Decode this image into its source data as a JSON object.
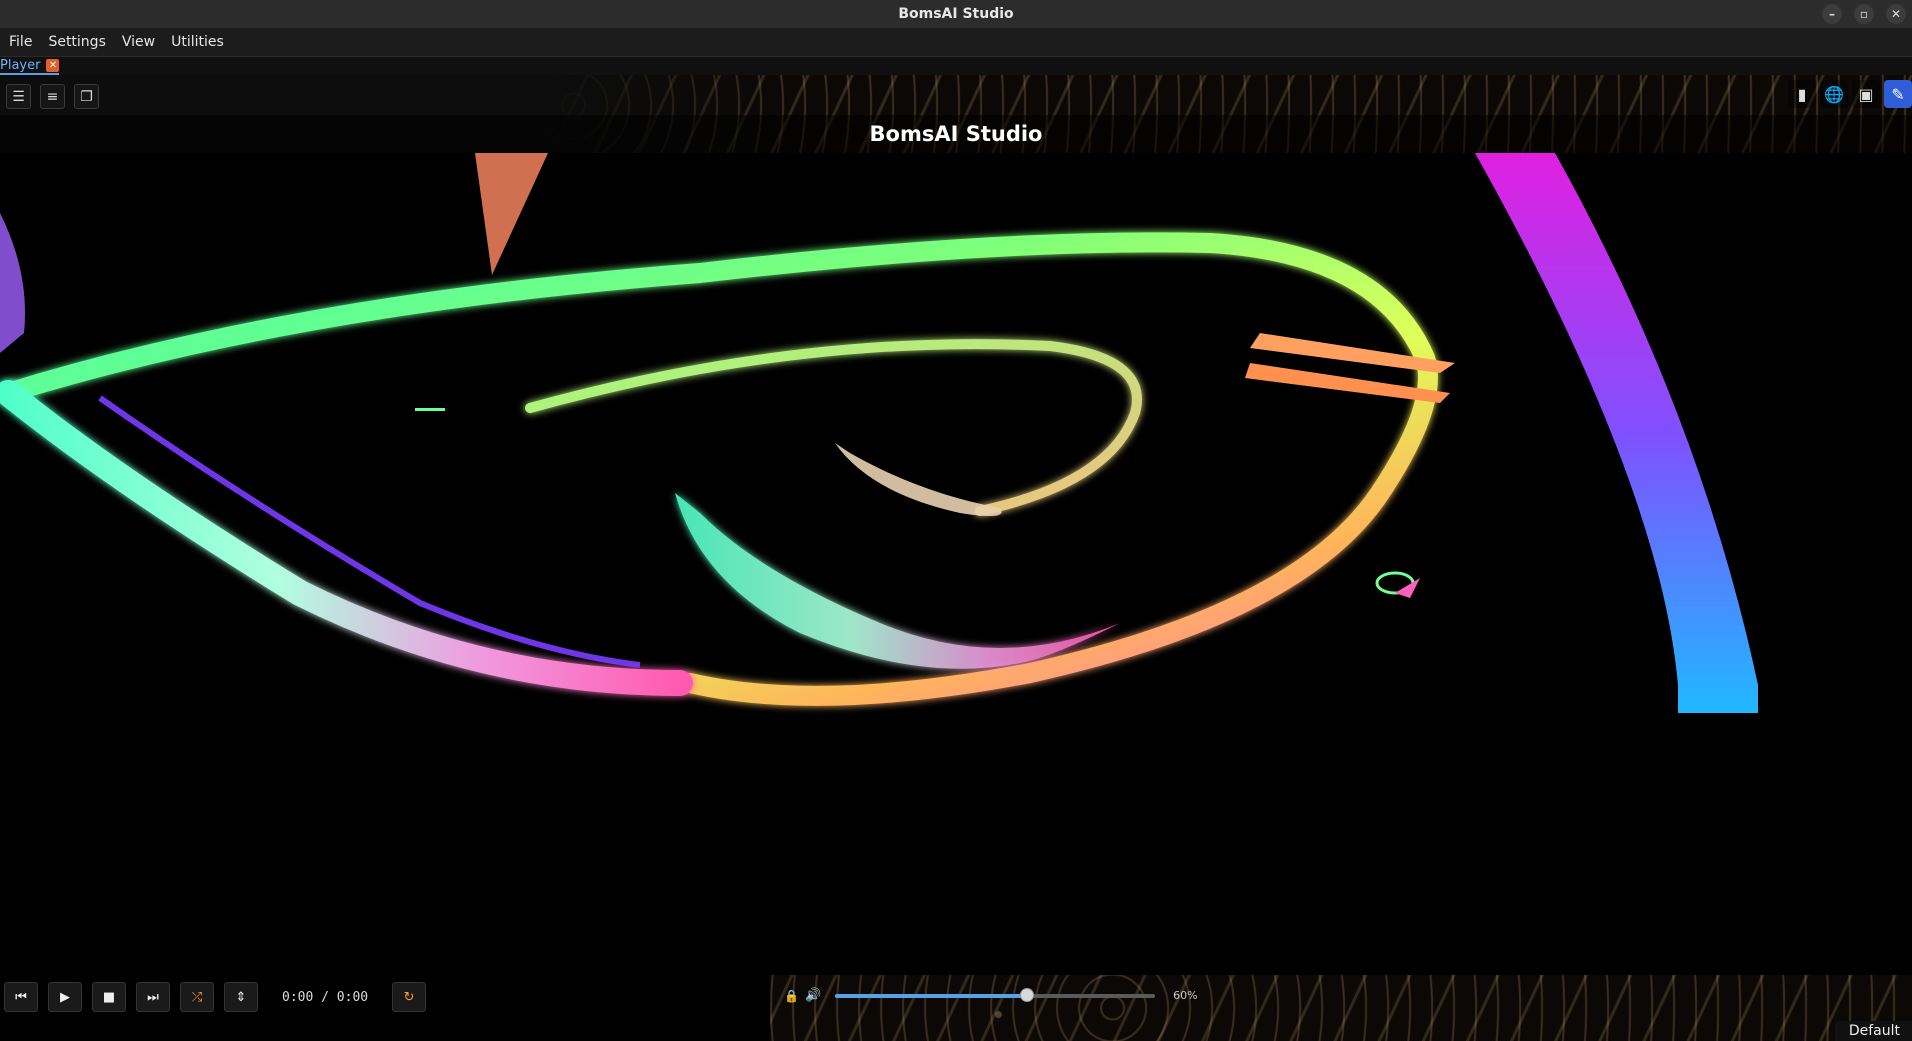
{
  "window": {
    "title": "BomsAI Studio"
  },
  "menu": [
    "File",
    "Settings",
    "View",
    "Utilities"
  ],
  "tabs": [
    {
      "label": "Player",
      "close": "x"
    }
  ],
  "toolbar": {
    "left": [
      "☰",
      "≡",
      "❐"
    ],
    "right_icons": [
      "sidebar-icon",
      "globe-icon",
      "image-icon",
      "brush-icon"
    ]
  },
  "brand": {
    "title": "BomsAI Studio"
  },
  "player": {
    "time": "0:00 / 0:00",
    "volume_label": "60%",
    "volume": 0.6
  },
  "status": {
    "profile": "Default"
  },
  "colors": {
    "accent": "#5aa0e6",
    "orange": "#ff9a2a"
  }
}
